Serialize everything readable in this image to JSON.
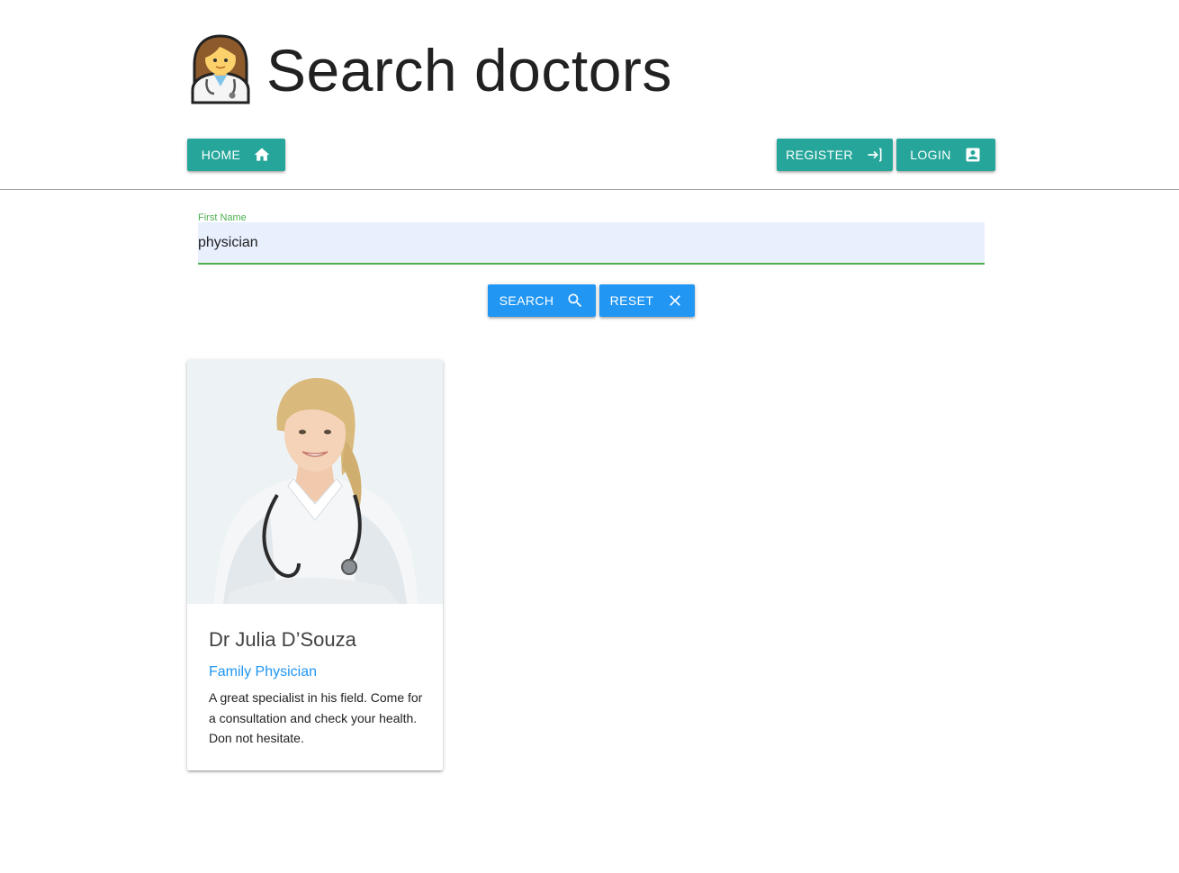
{
  "header": {
    "title": "Search doctors",
    "icon": "woman-doctor-icon"
  },
  "nav": {
    "home_label": "HOME",
    "register_label": "REGISTER",
    "login_label": "LOGIN"
  },
  "search_form": {
    "first_name_label": "First Name",
    "first_name_value": "physician",
    "search_label": "SEARCH",
    "reset_label": "RESET"
  },
  "results": [
    {
      "name": "Dr Julia D’Souza",
      "specialty": "Family Physician",
      "description": "A great specialist in his field. Come for a consultation and check your health. Don not hesitate."
    }
  ],
  "colors": {
    "teal": "#26a69a",
    "blue": "#2196f3",
    "focus_green": "#4caf50",
    "input_bg": "#e8f0fe"
  }
}
